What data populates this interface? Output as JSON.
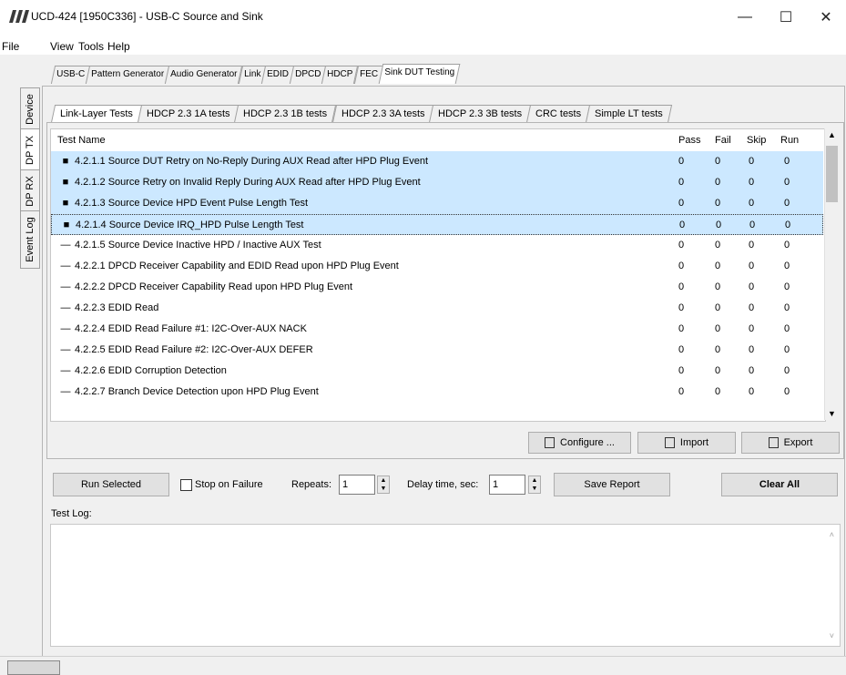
{
  "window": {
    "title": "UCD-424 [1950C336] - USB-C Source and Sink",
    "minimize": "—",
    "maximize": "☐",
    "close": "✕"
  },
  "menu": {
    "file": "File",
    "view": "View",
    "tools": "Tools",
    "help": "Help"
  },
  "top_tabs": [
    "USB-C",
    "Pattern Generator",
    "Audio Generator",
    "Link",
    "EDID",
    "DPCD",
    "HDCP",
    "FEC",
    "Sink DUT Testing"
  ],
  "side_tabs": [
    "Device",
    "DP TX",
    "DP RX",
    "Event Log"
  ],
  "inner_tabs": [
    "Link-Layer Tests",
    "HDCP 2.3 1A tests",
    "HDCP 2.3 1B tests",
    "HDCP 2.3 3A tests",
    "HDCP 2.3 3B tests",
    "CRC tests",
    "Simple LT tests"
  ],
  "table": {
    "headers": {
      "name": "Test Name",
      "pass": "Pass",
      "fail": "Fail",
      "skip": "Skip",
      "run": "Run"
    },
    "rows": [
      {
        "bullet": "■",
        "name": "4.2.1.1 Source DUT Retry on No-Reply During AUX Read after HPD Plug Event",
        "pass": "0",
        "fail": "0",
        "skip": "0",
        "run": "0"
      },
      {
        "bullet": "■",
        "name": "4.2.1.2 Source Retry on Invalid Reply During AUX Read after HPD Plug Event",
        "pass": "0",
        "fail": "0",
        "skip": "0",
        "run": "0"
      },
      {
        "bullet": "■",
        "name": "4.2.1.3 Source Device HPD Event Pulse Length Test",
        "pass": "0",
        "fail": "0",
        "skip": "0",
        "run": "0"
      },
      {
        "bullet": "■",
        "name": "4.2.1.4 Source Device IRQ_HPD Pulse Length Test",
        "pass": "0",
        "fail": "0",
        "skip": "0",
        "run": "0"
      },
      {
        "bullet": "—",
        "name": "4.2.1.5 Source Device Inactive HPD / Inactive AUX Test",
        "pass": "0",
        "fail": "0",
        "skip": "0",
        "run": "0"
      },
      {
        "bullet": "—",
        "name": "4.2.2.1 DPCD Receiver Capability and EDID Read upon HPD Plug Event",
        "pass": "0",
        "fail": "0",
        "skip": "0",
        "run": "0"
      },
      {
        "bullet": "—",
        "name": "4.2.2.2 DPCD Receiver Capability Read upon HPD Plug Event",
        "pass": "0",
        "fail": "0",
        "skip": "0",
        "run": "0"
      },
      {
        "bullet": "—",
        "name": "4.2.2.3 EDID Read",
        "pass": "0",
        "fail": "0",
        "skip": "0",
        "run": "0"
      },
      {
        "bullet": "—",
        "name": "4.2.2.4 EDID Read Failure #1: I2C-Over-AUX NACK",
        "pass": "0",
        "fail": "0",
        "skip": "0",
        "run": "0"
      },
      {
        "bullet": "—",
        "name": "4.2.2.5 EDID Read Failure #2: I2C-Over-AUX DEFER",
        "pass": "0",
        "fail": "0",
        "skip": "0",
        "run": "0"
      },
      {
        "bullet": "—",
        "name": "4.2.2.6 EDID Corruption Detection",
        "pass": "0",
        "fail": "0",
        "skip": "0",
        "run": "0"
      },
      {
        "bullet": "—",
        "name": "4.2.2.7 Branch Device Detection upon HPD Plug Event",
        "pass": "0",
        "fail": "0",
        "skip": "0",
        "run": "0"
      }
    ]
  },
  "buttons": {
    "configure": "Configure ...",
    "import": "Import",
    "export": "Export",
    "run_selected": "Run Selected",
    "stop_on_failure": "Stop on Failure",
    "repeats_label": "Repeats:",
    "repeats_value": "1",
    "delay_label": "Delay time, sec:",
    "delay_value": "1",
    "save_report": "Save Report",
    "clear_all": "Clear All"
  },
  "test_log_label": "Test Log:"
}
